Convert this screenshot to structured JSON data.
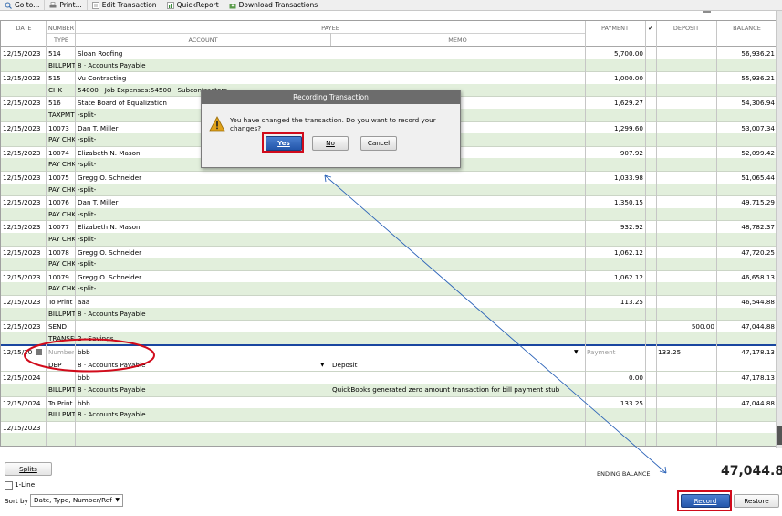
{
  "toolbar": {
    "items": [
      {
        "label": "Go to...",
        "icon": "goto-icon"
      },
      {
        "label": "Print...",
        "icon": "print-icon"
      },
      {
        "label": "Edit Transaction",
        "icon": "edit-icon"
      },
      {
        "label": "QuickReport",
        "icon": "report-icon"
      },
      {
        "label": "Download Transactions",
        "icon": "download-icon"
      }
    ]
  },
  "header": {
    "date": "DATE",
    "number": "NUMBER",
    "type": "TYPE",
    "payee": "PAYEE",
    "account": "ACCOUNT",
    "memo": "MEMO",
    "payment": "PAYMENT",
    "check": "✔",
    "deposit": "DEPOSIT",
    "balance": "BALANCE"
  },
  "transactions": [
    {
      "date": "12/15/2023",
      "number": "514",
      "payee": "Sloan Roofing",
      "payment": "5,700.00",
      "deposit": "",
      "balance": "56,936.21",
      "type": "BILLPMT",
      "account": "8 · Accounts Payable",
      "memo": ""
    },
    {
      "date": "12/15/2023",
      "number": "515",
      "payee": "Vu Contracting",
      "payment": "1,000.00",
      "deposit": "",
      "balance": "55,936.21",
      "type": "CHK",
      "account": "54000 · Job Expenses:54500 · Subcontractors",
      "memo": ""
    },
    {
      "date": "12/15/2023",
      "number": "516",
      "payee": "State Board of Equalization",
      "payment": "1,629.27",
      "deposit": "",
      "balance": "54,306.94",
      "type": "TAXPMT",
      "account": "-split-",
      "memo": ""
    },
    {
      "date": "12/15/2023",
      "number": "10073",
      "payee": "Dan T. Miller",
      "payment": "1,299.60",
      "deposit": "",
      "balance": "53,007.34",
      "type": "PAY CHK",
      "account": "-split-",
      "memo": ""
    },
    {
      "date": "12/15/2023",
      "number": "10074",
      "payee": "Elizabeth N. Mason",
      "payment": "907.92",
      "deposit": "",
      "balance": "52,099.42",
      "type": "PAY CHK",
      "account": "-split-",
      "memo": ""
    },
    {
      "date": "12/15/2023",
      "number": "10075",
      "payee": "Gregg O. Schneider",
      "payment": "1,033.98",
      "deposit": "",
      "balance": "51,065.44",
      "type": "PAY CHK",
      "account": "-split-",
      "memo": ""
    },
    {
      "date": "12/15/2023",
      "number": "10076",
      "payee": "Dan T. Miller",
      "payment": "1,350.15",
      "deposit": "",
      "balance": "49,715.29",
      "type": "PAY CHK",
      "account": "-split-",
      "memo": ""
    },
    {
      "date": "12/15/2023",
      "number": "10077",
      "payee": "Elizabeth N. Mason",
      "payment": "932.92",
      "deposit": "",
      "balance": "48,782.37",
      "type": "PAY CHK",
      "account": "-split-",
      "memo": ""
    },
    {
      "date": "12/15/2023",
      "number": "10078",
      "payee": "Gregg O. Schneider",
      "payment": "1,062.12",
      "deposit": "",
      "balance": "47,720.25",
      "type": "PAY CHK",
      "account": "-split-",
      "memo": ""
    },
    {
      "date": "12/15/2023",
      "number": "10079",
      "payee": "Gregg O. Schneider",
      "payment": "1,062.12",
      "deposit": "",
      "balance": "46,658.13",
      "type": "PAY CHK",
      "account": "-split-",
      "memo": ""
    },
    {
      "date": "12/15/2023",
      "number": "To Print",
      "payee": "aaa",
      "payment": "113.25",
      "deposit": "",
      "balance": "46,544.88",
      "type": "BILLPMT",
      "account": "8 · Accounts Payable",
      "memo": ""
    },
    {
      "date": "12/15/2023",
      "number": "SEND",
      "payee": "",
      "payment": "",
      "deposit": "500.00",
      "balance": "47,044.88",
      "type": "TRANSFR",
      "account": "2 · Savings",
      "memo": ""
    }
  ],
  "editing": {
    "date": "12/15/20",
    "number_placeholder": "Number",
    "payee": "bbb",
    "payment_placeholder": "Payment",
    "deposit": "133.25",
    "balance": "47,178.13",
    "type": "DEP",
    "account": "8 · Accounts Payable",
    "memo": "Deposit"
  },
  "after": [
    {
      "date": "12/15/2024",
      "number": "",
      "payee": "bbb",
      "payment": "0.00",
      "deposit": "",
      "balance": "47,178.13",
      "type": "BILLPMT",
      "account": "8 · Accounts Payable",
      "memo": "QuickBooks generated zero amount transaction for bill payment stub"
    },
    {
      "date": "12/15/2024",
      "number": "To Print",
      "payee": "bbb",
      "payment": "133.25",
      "deposit": "",
      "balance": "47,044.88",
      "type": "BILLPMT",
      "account": "8 · Accounts Payable",
      "memo": ""
    },
    {
      "date": "12/15/2023",
      "number": "",
      "payee": "",
      "payment": "",
      "deposit": "",
      "balance": "",
      "type": "",
      "account": "",
      "memo": ""
    }
  ],
  "dialog": {
    "title": "Recording Transaction",
    "message": "You have changed the transaction. Do you want to record your changes?",
    "yes": "Yes",
    "no": "No",
    "cancel": "Cancel"
  },
  "bottom": {
    "splits": "Splits",
    "one_line": "1-Line",
    "sort_by": "Sort by",
    "sort_value": "Date, Type, Number/Ref",
    "ending_balance_label": "ENDING BALANCE",
    "ending_balance": "47,044.88",
    "record": "Record",
    "restore": "Restore"
  },
  "colors": {
    "row_alt": "#e2efdc",
    "highlight": "#d10b1b",
    "primary_button": "#2356aa",
    "arrow": "#2a62b8"
  }
}
